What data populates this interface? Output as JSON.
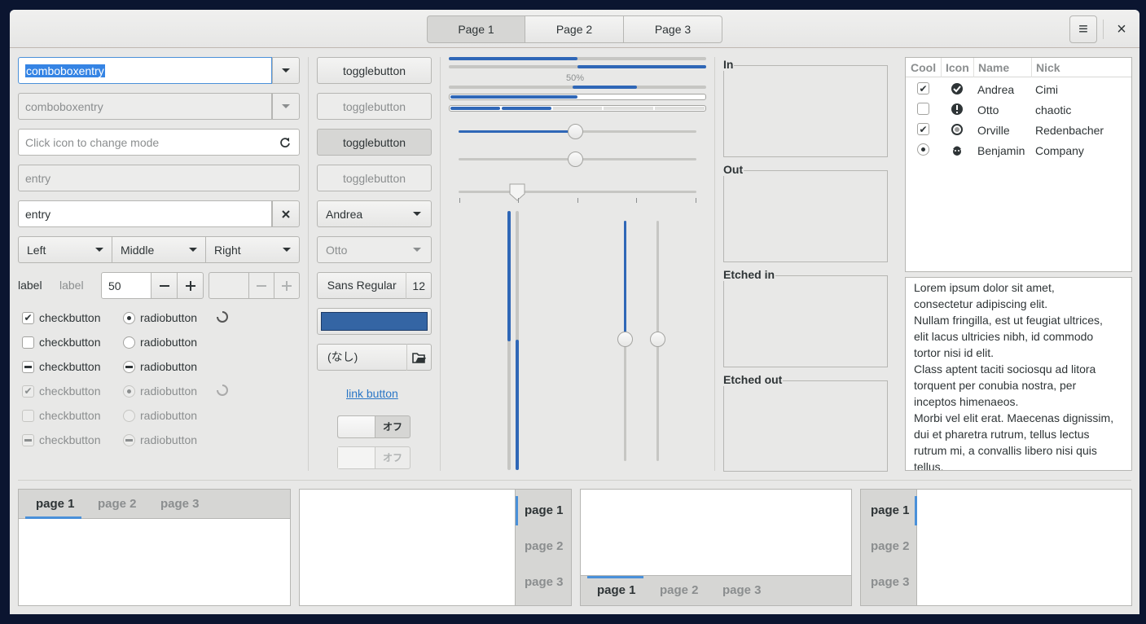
{
  "header": {
    "stack_tabs": [
      "Page 1",
      "Page 2",
      "Page 3"
    ],
    "menu_icon": "hamburger-menu-icon",
    "close_icon": "close-icon",
    "close_glyph": "×",
    "menu_glyph": "≡"
  },
  "col1": {
    "combo1_value": "comboboxentry",
    "combo2_value": "comboboxentry",
    "entry_mode_placeholder": "Click icon to change mode",
    "entry_disabled": "entry",
    "entry_value": "entry",
    "segments": [
      "Left",
      "Middle",
      "Right"
    ],
    "label1": "label",
    "label2": "label",
    "spin_value": "50",
    "check_label": "checkbutton",
    "radio_label": "radiobutton"
  },
  "col2": {
    "toggle_label": "togglebutton",
    "combo_andrea": "Andrea",
    "combo_otto": "Otto",
    "font_name": "Sans Regular",
    "font_size": "12",
    "color_value": "#3465a4",
    "file_chooser": "(なし)",
    "link_button": "link button",
    "switch_off": "オフ"
  },
  "col3": {
    "progress_text": "50%",
    "progress_levels": [
      0.5,
      0.5,
      0.25,
      0.5,
      0.6
    ]
  },
  "frames": [
    "In",
    "Out",
    "Etched in",
    "Etched out"
  ],
  "tree": {
    "columns": [
      "Cool",
      "Icon",
      "Name",
      "Nick"
    ],
    "rows": [
      {
        "name": "Andrea",
        "nick": "Cimi",
        "cool": "checked",
        "icon": "check-circle-icon"
      },
      {
        "name": "Otto",
        "nick": "chaotic",
        "cool": "unchecked",
        "icon": "exclamation-circle-icon"
      },
      {
        "name": "Orville",
        "nick": "Redenbacher",
        "cool": "checked",
        "icon": "circle-icon"
      },
      {
        "name": "Benjamin",
        "nick": "Company",
        "cool": "radio",
        "icon": "face-icon"
      }
    ]
  },
  "text_view": [
    "Lorem ipsum dolor sit amet,",
    "consectetur adipiscing elit.",
    "Nullam fringilla, est ut feugiat ultrices,",
    "elit lacus ultricies nibh, id commodo",
    "tortor nisi id elit.",
    "Class aptent taciti sociosqu ad litora",
    "torquent per conubia nostra, per",
    "inceptos himenaeos.",
    "Morbi vel elit erat. Maecenas dignissim,",
    "dui et pharetra rutrum, tellus lectus",
    "rutrum mi, a convallis libero nisi quis",
    "tellus."
  ],
  "notebooks": {
    "tabs": [
      "page 1",
      "page 2",
      "page 3"
    ]
  }
}
